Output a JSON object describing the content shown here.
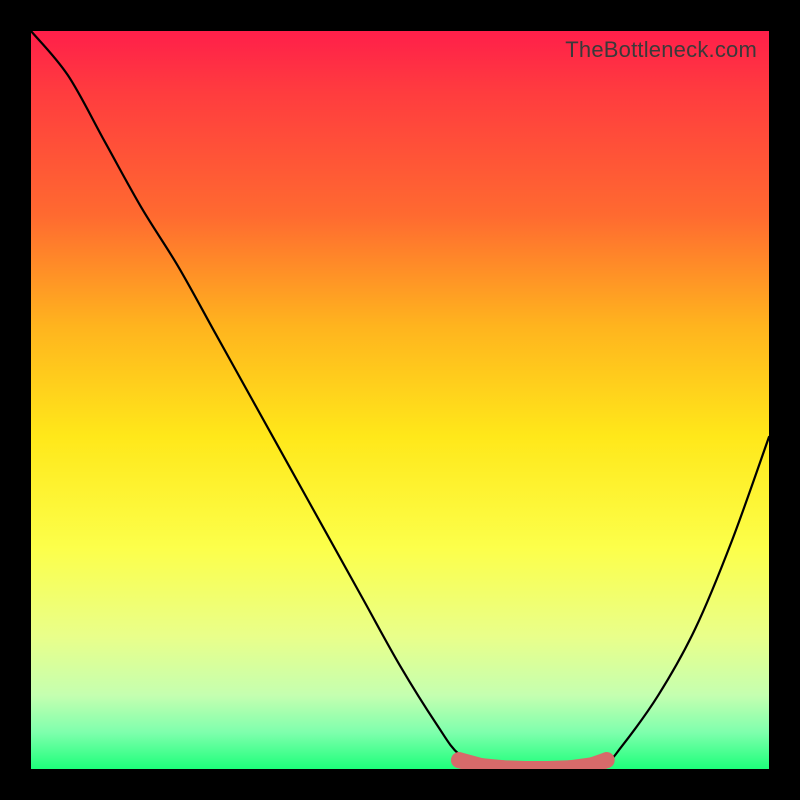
{
  "watermark": "TheBottleneck.com",
  "chart_data": {
    "type": "line",
    "title": "",
    "xlabel": "",
    "ylabel": "",
    "xlim": [
      0,
      100
    ],
    "ylim": [
      0,
      100
    ],
    "grid": false,
    "series": [
      {
        "name": "curve",
        "color": "#000000",
        "x": [
          0,
          5,
          10,
          15,
          20,
          25,
          30,
          35,
          40,
          45,
          50,
          55,
          58,
          62,
          66,
          70,
          74,
          78,
          80,
          85,
          90,
          95,
          100
        ],
        "y": [
          100,
          94,
          85,
          76,
          68,
          59,
          50,
          41,
          32,
          23,
          14,
          6,
          2,
          0,
          0,
          0,
          0,
          1,
          3,
          10,
          19,
          31,
          45
        ]
      }
    ],
    "markers": {
      "name": "highlight",
      "color": "#d76a6a",
      "x": [
        58,
        61,
        64,
        67,
        70,
        73,
        76,
        78
      ],
      "y": [
        1.2,
        0.4,
        0.1,
        0,
        0,
        0.1,
        0.5,
        1.2
      ]
    }
  }
}
